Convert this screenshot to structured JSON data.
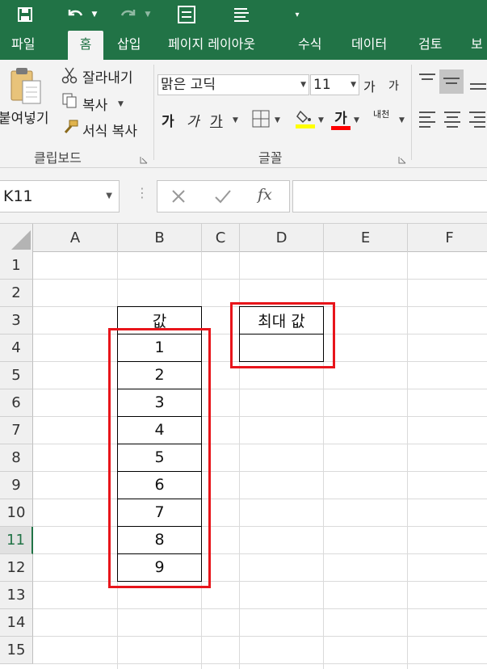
{
  "qat": {
    "icons": [
      "save-icon",
      "undo-icon",
      "redo-icon",
      "form-icon",
      "list-icon",
      "customize-icon"
    ]
  },
  "tabs": [
    "파일",
    "홈",
    "삽입",
    "페이지 레이아웃",
    "수식",
    "데이터",
    "검토",
    "보"
  ],
  "active_tab": "홈",
  "ribbon": {
    "clipboard": {
      "paste": "붙여넣기",
      "cut": "잘라내기",
      "copy": "복사",
      "format_painter": "서식 복사",
      "label": "클립보드"
    },
    "font": {
      "font_name": "맑은 고딕",
      "font_size": "11",
      "grow": "가",
      "shrink": "가",
      "bold": "가",
      "italic": "가",
      "underline": "가",
      "font_color_glyph": "가",
      "phonetic": "내천",
      "label": "글꼴",
      "fill_color": "#ffff00",
      "font_color": "#ff0000"
    }
  },
  "formula_bar": {
    "name_box": "K11",
    "fx": "fx",
    "value": ""
  },
  "grid": {
    "columns": [
      "A",
      "B",
      "C",
      "D",
      "E",
      "F"
    ],
    "rows": [
      "1",
      "2",
      "3",
      "4",
      "5",
      "6",
      "7",
      "8",
      "9",
      "10",
      "11",
      "12",
      "13",
      "14",
      "15"
    ],
    "selected_row": "11",
    "value_header": "값",
    "values": [
      "1",
      "2",
      "3",
      "4",
      "5",
      "6",
      "7",
      "8",
      "9"
    ],
    "max_header": "최대 값",
    "max_value": "",
    "accent": "#217346",
    "highlight": "#e8151b"
  }
}
